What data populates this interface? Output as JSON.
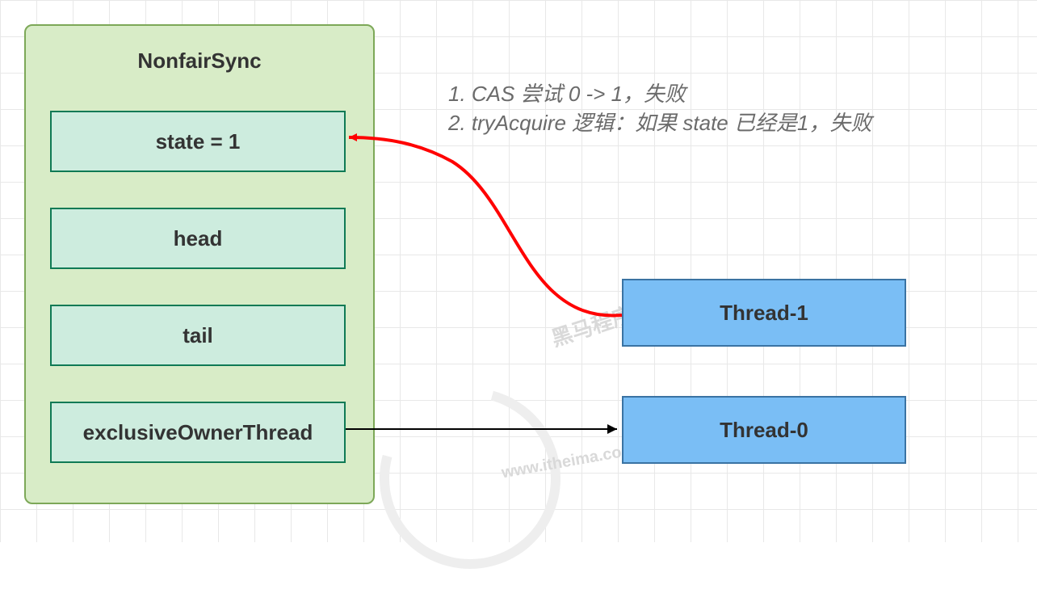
{
  "sync": {
    "title": "NonfairSync",
    "state_label": "state = 1",
    "head_label": "head",
    "tail_label": "tail",
    "owner_label": "exclusiveOwnerThread"
  },
  "threads": {
    "t1_label": "Thread-1",
    "t0_label": "Thread-0"
  },
  "annotation": {
    "line1": "1. CAS 尝试 0 -> 1，失败",
    "line2": "2. tryAcquire 逻辑：如果 state 已经是1，失败"
  },
  "colors": {
    "sync_fill": "#d8ecc7",
    "sync_border": "#7da858",
    "field_fill": "#cdecde",
    "field_border": "#0f7a55",
    "thread_fill": "#7abef5",
    "thread_border": "#3a73a3",
    "arrow_red": "#ff0000",
    "arrow_black": "#000000"
  }
}
